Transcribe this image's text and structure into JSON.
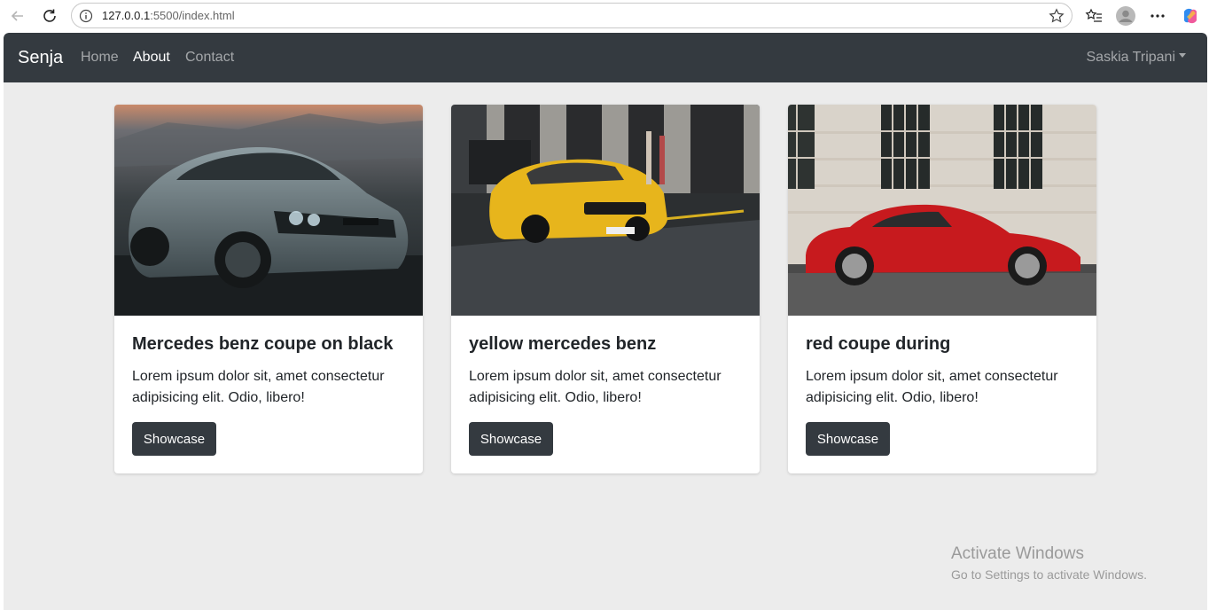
{
  "browser": {
    "url_host": "127.0.0.1",
    "url_rest": ":5500/index.html"
  },
  "navbar": {
    "brand": "Senja",
    "links": [
      {
        "label": "Home",
        "active": false
      },
      {
        "label": "About",
        "active": true
      },
      {
        "label": "Contact",
        "active": false
      }
    ],
    "user": "Saskia Tripani"
  },
  "cards": [
    {
      "title": "Mercedes benz coupe on black",
      "text": "Lorem ipsum dolor sit, amet consectetur adipisicing elit. Odio, libero!",
      "button": "Showcase",
      "image": "silver-car-photo"
    },
    {
      "title": "yellow mercedes benz",
      "text": "Lorem ipsum dolor sit, amet consectetur adipisicing elit. Odio, libero!",
      "button": "Showcase",
      "image": "yellow-car-photo"
    },
    {
      "title": "red coupe during",
      "text": "Lorem ipsum dolor sit, amet consectetur adipisicing elit. Odio, libero!",
      "button": "Showcase",
      "image": "red-car-photo"
    }
  ],
  "watermark": {
    "line1": "Activate Windows",
    "line2": "Go to Settings to activate Windows."
  },
  "colors": {
    "navbar": "#343a40",
    "page_bg": "#ececec",
    "button": "#343a40"
  }
}
